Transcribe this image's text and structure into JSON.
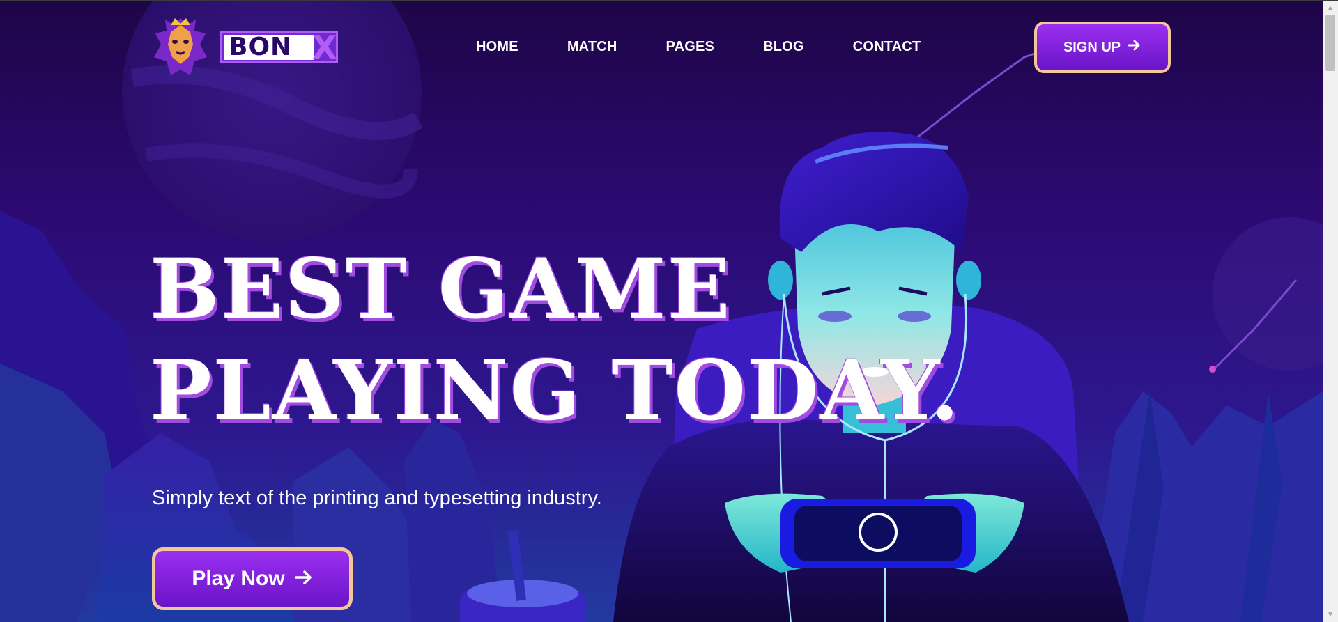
{
  "brand": {
    "name": "BON",
    "name_accent": "X"
  },
  "nav": {
    "items": [
      {
        "label": "HOME"
      },
      {
        "label": "MATCH"
      },
      {
        "label": "PAGES"
      },
      {
        "label": "BLOG"
      },
      {
        "label": "CONTACT"
      }
    ]
  },
  "header": {
    "signup_label": "SIGN UP",
    "signup_icon": "arrow-right-icon"
  },
  "hero": {
    "headline_line1": "BEST GAME",
    "headline_line2": "PLAYING TODAY.",
    "subtitle": "Simply text of the printing and typesetting industry.",
    "cta_label": "Play Now",
    "cta_icon": "arrow-right-icon"
  },
  "colors": {
    "background": "#2a0868",
    "accent": "#9b2ff0",
    "button_border": "#f4c79a",
    "headline_shadow": "#a14be0"
  }
}
